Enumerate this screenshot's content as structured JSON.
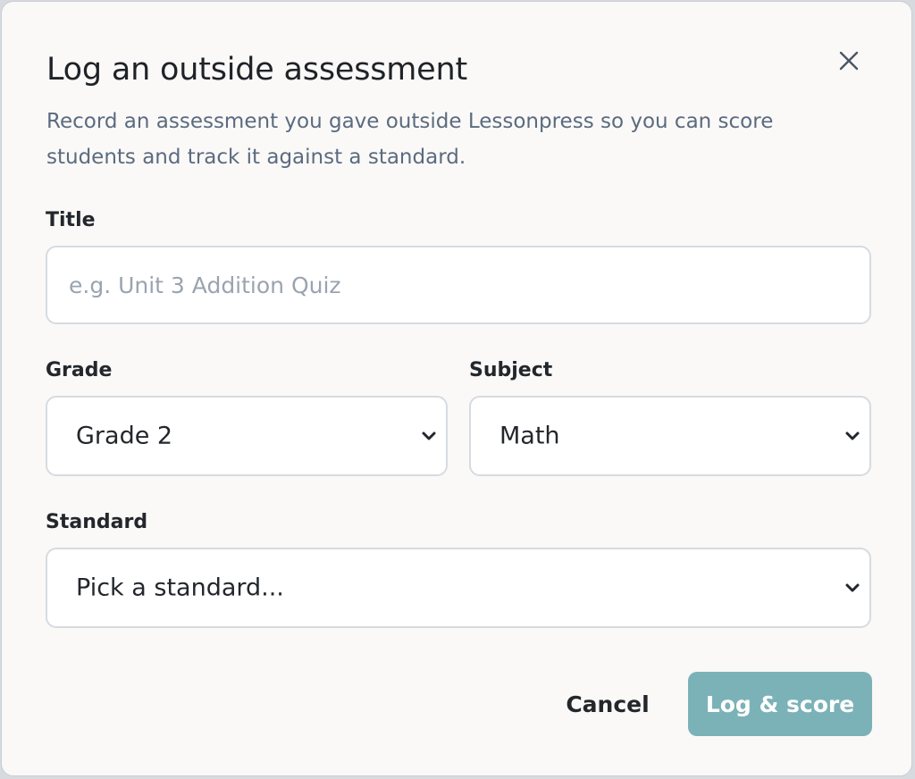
{
  "dialog": {
    "title": "Log an outside assessment",
    "subtitle": "Record an assessment you gave outside Lessonpress so you can score students and track it against a standard.",
    "close_icon": "close-icon"
  },
  "fields": {
    "title": {
      "label": "Title",
      "value": "",
      "placeholder": "e.g. Unit 3 Addition Quiz"
    },
    "grade": {
      "label": "Grade",
      "selected": "Grade 2",
      "icon": "chevron-down-icon"
    },
    "subject": {
      "label": "Subject",
      "selected": "Math",
      "icon": "chevron-down-icon"
    },
    "standard": {
      "label": "Standard",
      "selected": "Pick a standard...",
      "icon": "chevron-down-icon"
    }
  },
  "actions": {
    "cancel_label": "Cancel",
    "submit_label": "Log & score"
  },
  "colors": {
    "primary_button": "#7bb2b8",
    "dialog_background": "#faf9f8",
    "subtitle_text": "#5b6b7f"
  }
}
